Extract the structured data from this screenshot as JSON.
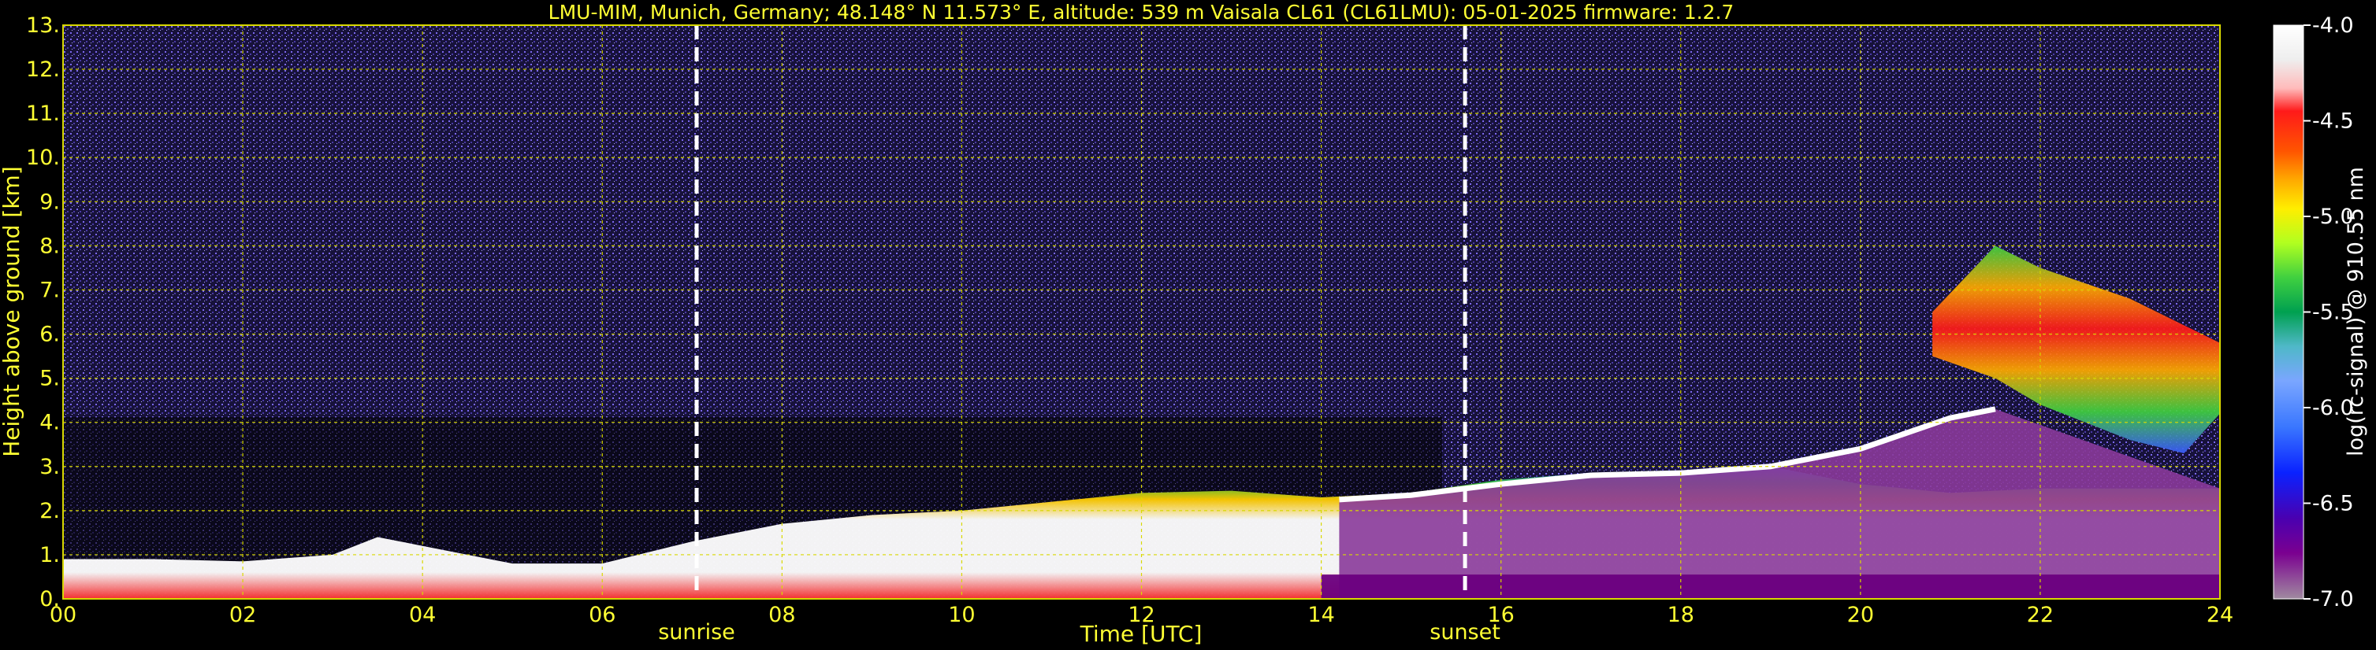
{
  "chart_data": {
    "type": "heatmap",
    "title": "LMU-MIM, Munich, Germany; 48.148° N 11.573° E, altitude: 539 m    Vaisala CL61 (CL61LMU): 05-01-2025    firmware: 1.2.7",
    "xlabel": "Time [UTC]",
    "ylabel": "Height above ground [km]",
    "xlim": [
      0,
      24
    ],
    "ylim": [
      0,
      13
    ],
    "x_ticks": [
      "00",
      "02",
      "04",
      "06",
      "08",
      "10",
      "12",
      "14",
      "16",
      "18",
      "20",
      "22",
      "24"
    ],
    "y_ticks": [
      "0.",
      "1.",
      "2.",
      "3.",
      "4.",
      "5.",
      "6.",
      "7.",
      "8.",
      "9.",
      "10.",
      "11.",
      "12.",
      "13."
    ],
    "grid": true,
    "markers": [
      {
        "label": "sunrise",
        "x": 7.05
      },
      {
        "label": "sunset",
        "x": 15.6
      }
    ],
    "colorbar": {
      "label": "log(rc-signal) @ 910.55 nm",
      "range": [
        -7.0,
        -4.0
      ],
      "ticks": [
        "-4.0",
        "-4.5",
        "-5.0",
        "-5.5",
        "-6.0",
        "-6.5",
        "-7.0"
      ]
    },
    "layers": {
      "boundary_layer_top": [
        [
          0,
          0.9
        ],
        [
          1,
          0.9
        ],
        [
          2,
          0.85
        ],
        [
          3,
          1.0
        ],
        [
          3.5,
          1.4
        ],
        [
          4,
          1.2
        ],
        [
          5,
          0.8
        ],
        [
          6,
          0.8
        ],
        [
          7,
          1.3
        ],
        [
          8,
          1.7
        ],
        [
          9,
          1.9
        ],
        [
          10,
          2.0
        ],
        [
          11,
          2.2
        ],
        [
          12,
          2.4
        ],
        [
          13,
          2.45
        ],
        [
          14,
          2.3
        ],
        [
          15,
          2.4
        ],
        [
          16,
          2.7
        ],
        [
          17,
          2.85
        ],
        [
          18,
          2.9
        ],
        [
          19,
          3.0
        ],
        [
          20,
          2.6
        ],
        [
          21,
          2.4
        ],
        [
          22,
          2.5
        ],
        [
          23,
          2.5
        ],
        [
          24,
          2.5
        ]
      ],
      "cloud_base": [
        [
          14.2,
          2.25
        ],
        [
          15,
          2.35
        ],
        [
          16,
          2.6
        ],
        [
          17,
          2.8
        ],
        [
          18,
          2.85
        ],
        [
          19,
          3.0
        ],
        [
          20,
          3.4
        ],
        [
          21,
          4.1
        ],
        [
          21.5,
          4.3
        ]
      ],
      "high_cloud_base": [
        [
          20.8,
          5.5
        ],
        [
          21.5,
          5.0
        ],
        [
          22,
          4.4
        ],
        [
          23,
          3.6
        ],
        [
          23.6,
          3.3
        ],
        [
          24,
          4.2
        ]
      ],
      "high_cloud_top": [
        [
          20.8,
          6.5
        ],
        [
          21.5,
          8.0
        ],
        [
          22,
          7.5
        ],
        [
          23,
          6.8
        ],
        [
          23.6,
          6.2
        ],
        [
          24,
          5.8
        ]
      ]
    },
    "colors": {
      "background": "#000000",
      "text": "#ffff33",
      "grid": "#d8d800",
      "noise": "#5b45c8",
      "colorbar_stops": [
        "#a08aa0",
        "#7a0090",
        "#4a00b0",
        "#0a22ff",
        "#3a77ff",
        "#7aa6ff",
        "#4fb8c8",
        "#00a050",
        "#40d040",
        "#b0ff20",
        "#ffee00",
        "#ffaa00",
        "#ff5500",
        "#ff1a1a",
        "#ffbbbb",
        "#eeeeee",
        "#ffffff"
      ]
    }
  }
}
